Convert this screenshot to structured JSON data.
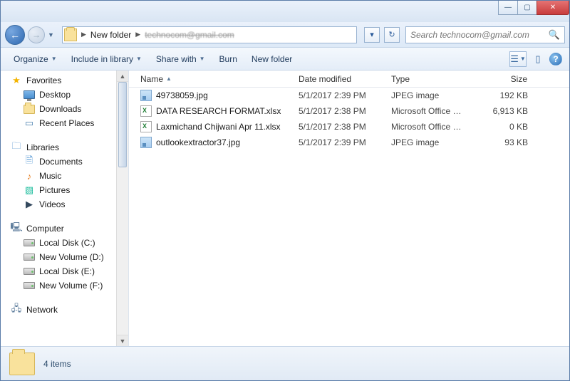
{
  "titlebar": {
    "min": "—",
    "max": "▢",
    "close": "✕"
  },
  "nav": {
    "back": "←",
    "fwd": "→",
    "path_seg1": "New folder",
    "path_seg2": "technocom@gmail.com",
    "search_placeholder": "Search technocom@gmail.com"
  },
  "toolbar": {
    "organize": "Organize",
    "include": "Include in library",
    "share": "Share with",
    "burn": "Burn",
    "newfolder": "New folder",
    "help": "?"
  },
  "sidebar": {
    "favorites": "Favorites",
    "desktop": "Desktop",
    "downloads": "Downloads",
    "recent": "Recent Places",
    "libraries": "Libraries",
    "documents": "Documents",
    "music": "Music",
    "pictures": "Pictures",
    "videos": "Videos",
    "computer": "Computer",
    "driveC": "Local Disk (C:)",
    "driveD": "New Volume (D:)",
    "driveE": "Local Disk (E:)",
    "driveF": "New Volume (F:)",
    "network": "Network"
  },
  "columns": {
    "name": "Name",
    "date": "Date modified",
    "type": "Type",
    "size": "Size"
  },
  "files": [
    {
      "name": "49738059.jpg",
      "date": "5/1/2017 2:39 PM",
      "type": "JPEG image",
      "size": "192 KB",
      "icon": "img"
    },
    {
      "name": "DATA RESEARCH FORMAT.xlsx",
      "date": "5/1/2017 2:38 PM",
      "type": "Microsoft Office E...",
      "size": "6,913 KB",
      "icon": "xls"
    },
    {
      "name": "Laxmichand Chijwani Apr 11.xlsx",
      "date": "5/1/2017 2:38 PM",
      "type": "Microsoft Office E...",
      "size": "0 KB",
      "icon": "xls"
    },
    {
      "name": "outlookextractor37.jpg",
      "date": "5/1/2017 2:39 PM",
      "type": "JPEG image",
      "size": "93 KB",
      "icon": "img"
    }
  ],
  "status": {
    "count": "4 items"
  }
}
